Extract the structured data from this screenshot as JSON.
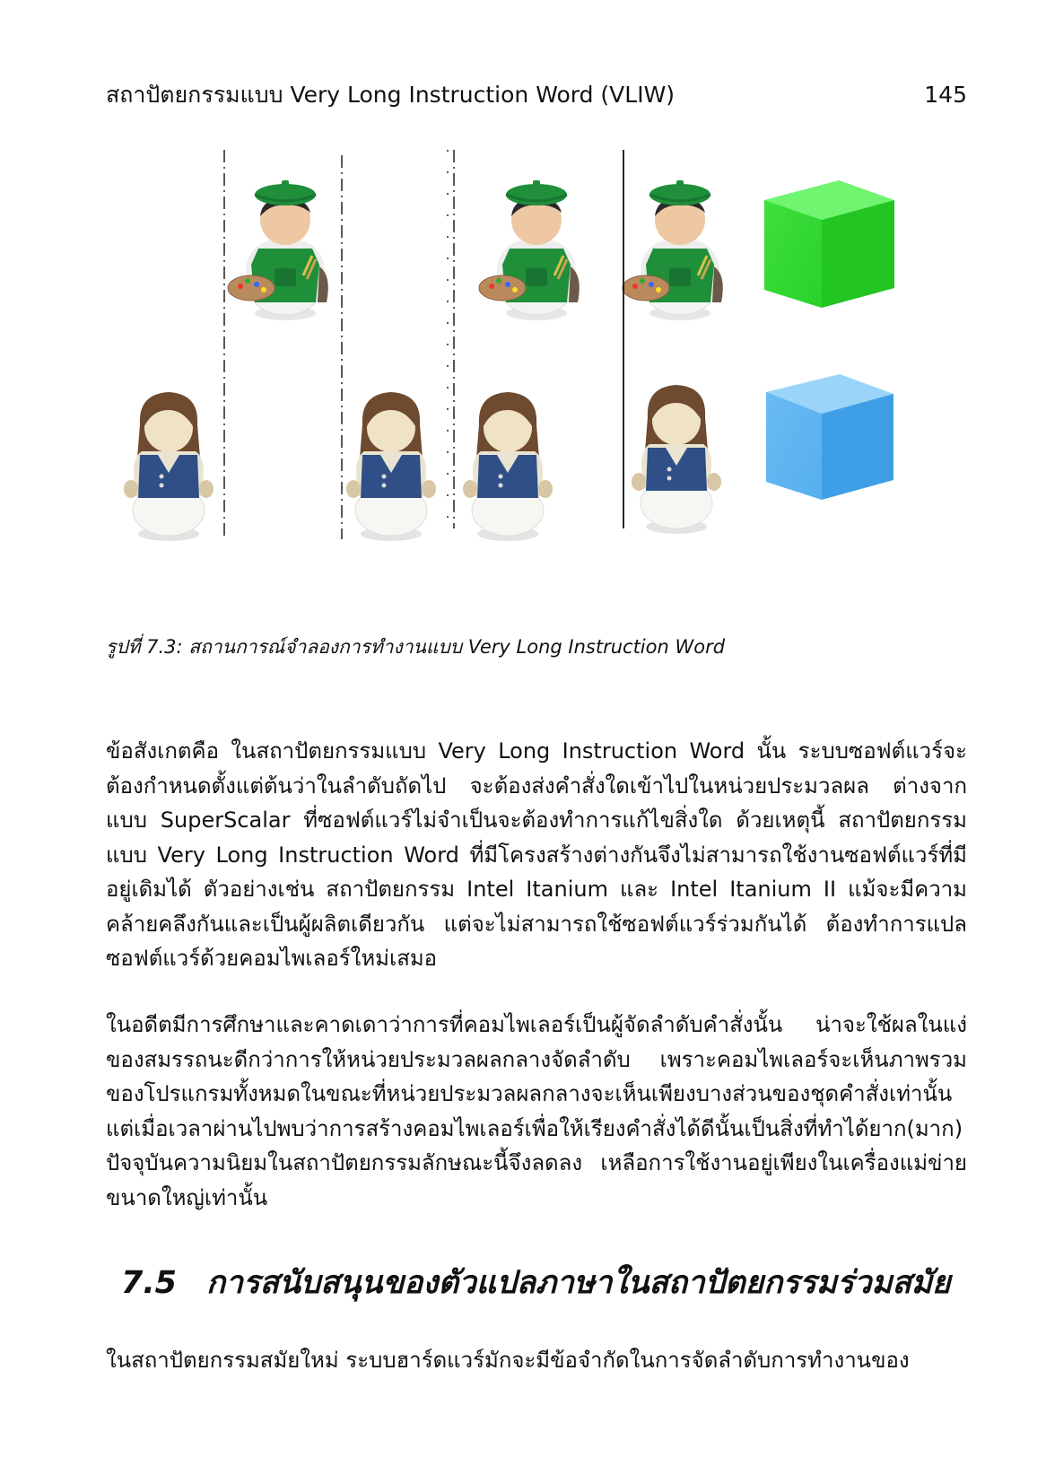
{
  "header": {
    "running_title": "สถาปัตยกรรมแบบ Very Long Instruction Word (VLIW)",
    "page_number": "145"
  },
  "figure": {
    "caption": "รูปที่ 7.3: สถานการณ์จำลองการทำงานแบบ Very Long Instruction Word",
    "icons": [
      "painter-icon",
      "waitress-icon",
      "green-cube-icon",
      "blue-cube-icon"
    ],
    "colors": {
      "painter_apron": "#1f8f3a",
      "waitress_vest": "#2f4f86",
      "green_cube": "#2ed82e",
      "blue_cube": "#3e9fe8"
    }
  },
  "body": {
    "paragraph_1": "ข้อสังเกตคือ ในสถาปัตยกรรมแบบ Very Long Instruction Word นั้น ระบบซอฟต์แวร์จะต้องกำหนดตั้งแต่ต้นว่าในลำดับถัดไป จะต้องส่งคำสั่งใดเข้าไปในหน่วยประมวลผล ต่างจากแบบ SuperScalar ที่ซอฟต์แวร์ไม่จำเป็นจะต้องทำการแก้ไขสิ่งใด ด้วยเหตุนี้ สถาปัตยกรรมแบบ Very Long Instruction Word ที่มีโครงสร้างต่างกันจึงไม่สามารถใช้งานซอฟต์แวร์ที่มีอยู่เดิมได้ ตัวอย่างเช่น สถาปัตยกรรม Intel Itanium และ Intel Itanium II แม้จะมีความคล้ายคลึงกันและเป็นผู้ผลิตเดียวกัน แต่จะไม่สามารถใช้ซอฟต์แวร์ร่วมกันได้ ต้องทำการแปลซอฟต์แวร์ด้วยคอมไพเลอร์ใหม่เสมอ",
    "paragraph_2": "ในอดีตมีการศึกษาและคาดเดาว่าการที่คอมไพเลอร์เป็นผู้จัดลำดับคำสั่งนั้น น่าจะใช้ผลในแง่ของสมรรถนะดีกว่าการให้หน่วยประมวลผลกลางจัดลำดับ เพราะคอมไพเลอร์จะเห็นภาพรวมของโปรแกรมทั้งหมดในขณะที่หน่วยประมวลผลกลางจะเห็นเพียงบางส่วนของชุดคำสั่งเท่านั้น แต่เมื่อเวลาผ่านไปพบว่าการสร้างคอมไพเลอร์เพื่อให้เรียงคำสั่งได้ดีนั้นเป็นสิ่งที่ทำได้ยาก(มาก) ปัจจุบันความนิยมในสถาปัตยกรรมลักษณะนี้จึงลดลง เหลือการใช้งานอยู่เพียงในเครื่องแม่ข่ายขนาดใหญ่เท่านั้น",
    "paragraph_3": "ในสถาปัตยกรรมสมัยใหม่ ระบบฮาร์ดแวร์มักจะมีข้อจำกัดในการจัดลำดับการทำงานของ"
  },
  "section": {
    "number": "7.5",
    "title": "การสนับสนุนของตัวแปลภาษาในสถาปัตยกรรมร่วมสมัย"
  }
}
